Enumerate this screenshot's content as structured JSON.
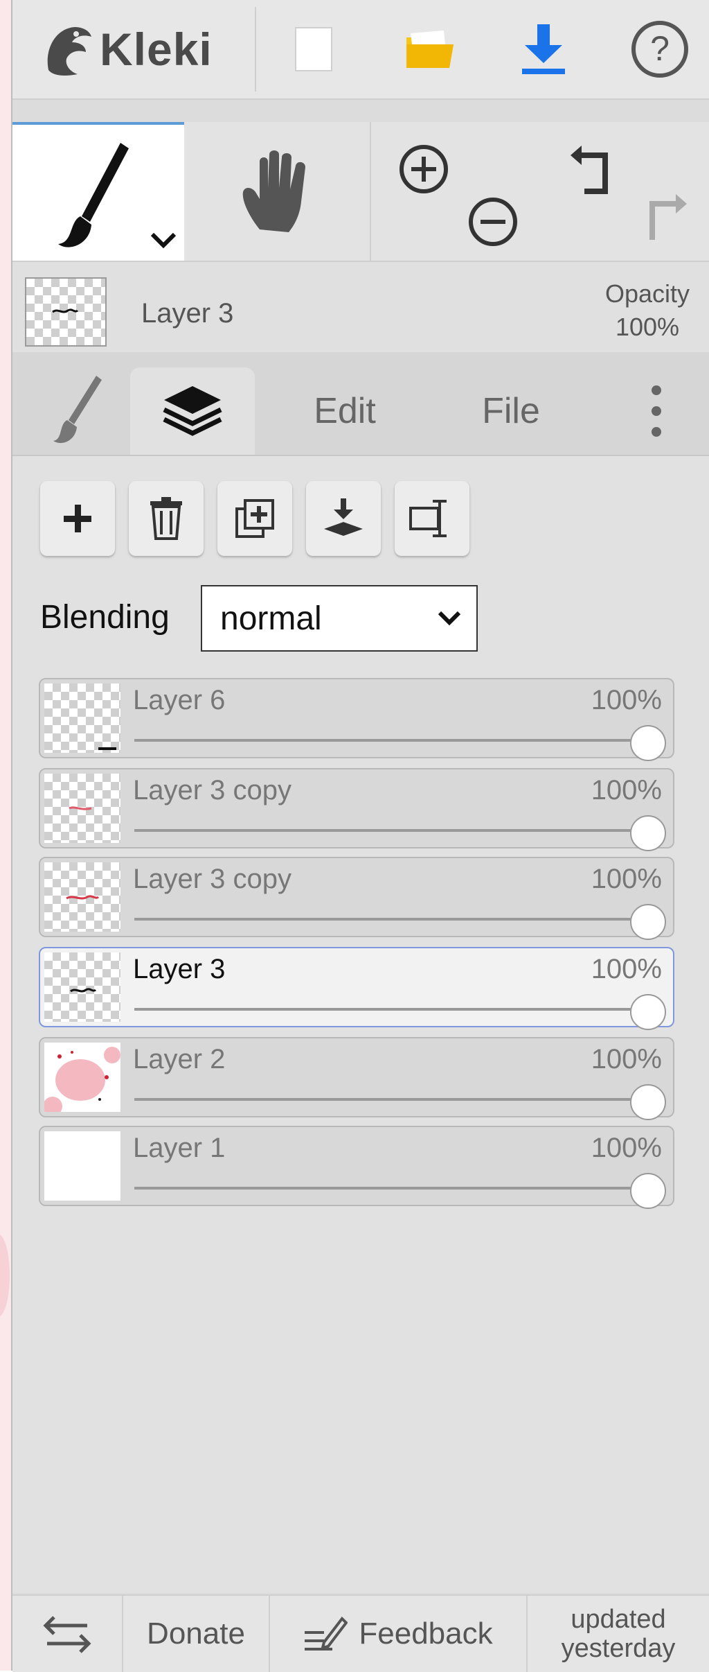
{
  "app": {
    "name": "Kleki"
  },
  "topbar": {
    "new_icon": "new-document-icon",
    "open_icon": "folder-icon",
    "save_icon": "download-icon",
    "help_icon": "help-icon",
    "colors": {
      "folder": "#f5c518",
      "download": "#1a73e8"
    }
  },
  "current_layer": {
    "name": "Layer 3",
    "opacity_label": "Opacity",
    "opacity_value": "100%"
  },
  "tabs": [
    {
      "icon": "brush-icon"
    },
    {
      "icon": "layers-icon",
      "active": true
    },
    {
      "label": "Edit"
    },
    {
      "label": "File"
    },
    {
      "icon": "more-vertical-icon"
    }
  ],
  "layer_actions": [
    "add-layer-icon",
    "trash-icon",
    "duplicate-layer-icon",
    "merge-down-icon",
    "rename-icon"
  ],
  "blending": {
    "label": "Blending",
    "value": "normal"
  },
  "layers": [
    {
      "name": "Layer 6",
      "opacity": "100%",
      "selected": false
    },
    {
      "name": "Layer 3 copy",
      "opacity": "100%",
      "selected": false
    },
    {
      "name": "Layer 3 copy",
      "opacity": "100%",
      "selected": false
    },
    {
      "name": "Layer 3",
      "opacity": "100%",
      "selected": true
    },
    {
      "name": "Layer 2",
      "opacity": "100%",
      "selected": false
    },
    {
      "name": "Layer 1",
      "opacity": "100%",
      "selected": false
    }
  ],
  "bottombar": {
    "swap_icon": "swap-arrows-icon",
    "donate": "Donate",
    "feedback": "Feedback",
    "updated_line1": "updated",
    "updated_line2": "yesterday"
  }
}
